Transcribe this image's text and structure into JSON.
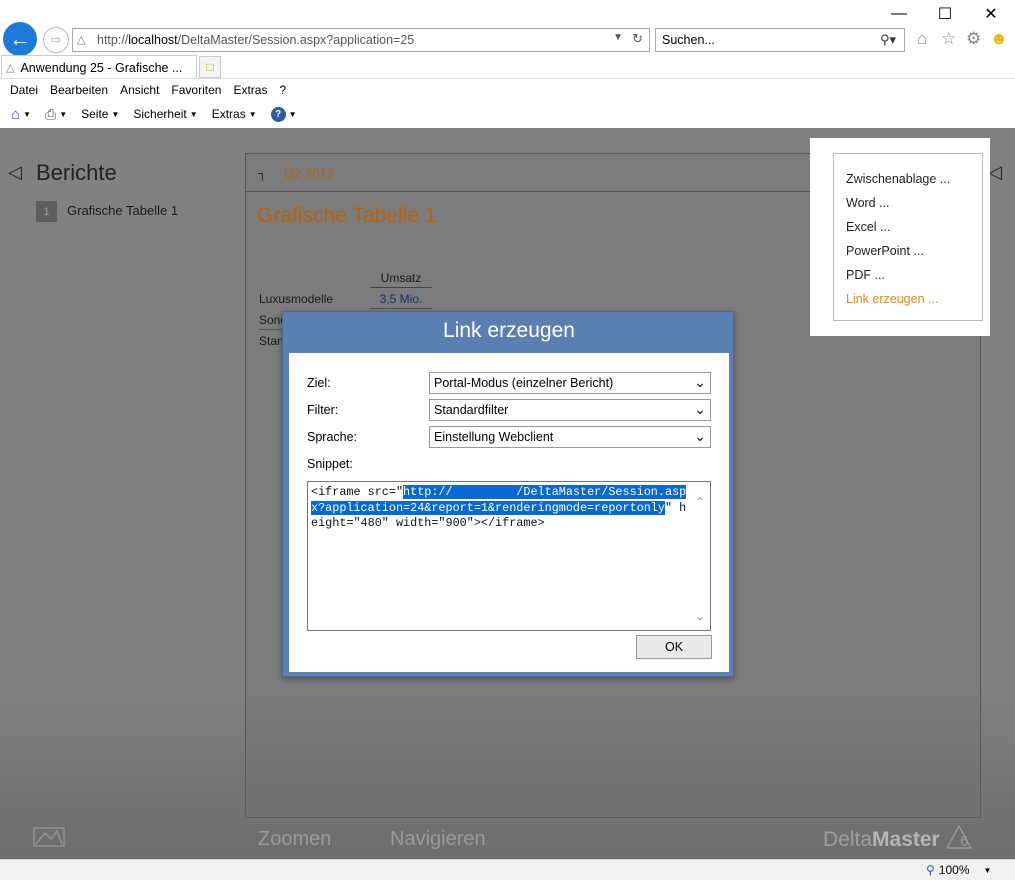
{
  "browser": {
    "address_prefix": "http://",
    "address_host": "localhost",
    "address_path": "/DeltaMaster/Session.aspx?application=25",
    "search_placeholder": "Suchen...",
    "tab_title": "Anwendung 25 - Grafische ...",
    "menu": [
      "Datei",
      "Bearbeiten",
      "Ansicht",
      "Favoriten",
      "Extras",
      "?"
    ],
    "commands": {
      "page": "Seite",
      "security": "Sicherheit",
      "tools": "Extras"
    },
    "zoom": "100%"
  },
  "sidebar": {
    "title": "Berichte",
    "reports": [
      {
        "number": "1",
        "name": "Grafische Tabelle 1"
      }
    ]
  },
  "report": {
    "period": "Q2 2012",
    "title": "Grafische Tabelle 1",
    "column_header": "Umsatz",
    "rows": [
      {
        "label": "Luxusmodelle",
        "value": "3,5 Mio."
      },
      {
        "label": "Sond",
        "value": ""
      },
      {
        "label": "Stan",
        "value": ""
      }
    ]
  },
  "export_menu": {
    "items": [
      "Zwischenablage ...",
      "Word ...",
      "Excel ...",
      "PowerPoint ...",
      "PDF ...",
      "Link erzeugen ..."
    ],
    "active_index": 5
  },
  "dialog": {
    "title": "Link erzeugen",
    "target_label": "Ziel:",
    "target_value": "Portal-Modus (einzelner Bericht)",
    "filter_label": "Filter:",
    "filter_value": "Standardfilter",
    "language_label": "Sprache:",
    "language_value": "Einstellung Webclient",
    "snippet_label": "Snippet:",
    "snippet_prefix": "<iframe src=\"",
    "snippet_selected": "http://         /DeltaMaster/Session.aspx?application=24&report=1&renderingmode=reportonly",
    "snippet_suffix": "\" height=\"480\" width=\"900\"></iframe>",
    "ok_label": "OK"
  },
  "bottom_bar": {
    "zoom_label": "Zoomen",
    "navigate_label": "Navigieren",
    "brand_light": "Delta",
    "brand_bold": "Master"
  },
  "colors": {
    "accent_orange": "#b8620b",
    "dialog_blue": "#5b7fb3",
    "selection_blue": "#0a68d4",
    "browser_back_blue": "#1c7ad8"
  }
}
